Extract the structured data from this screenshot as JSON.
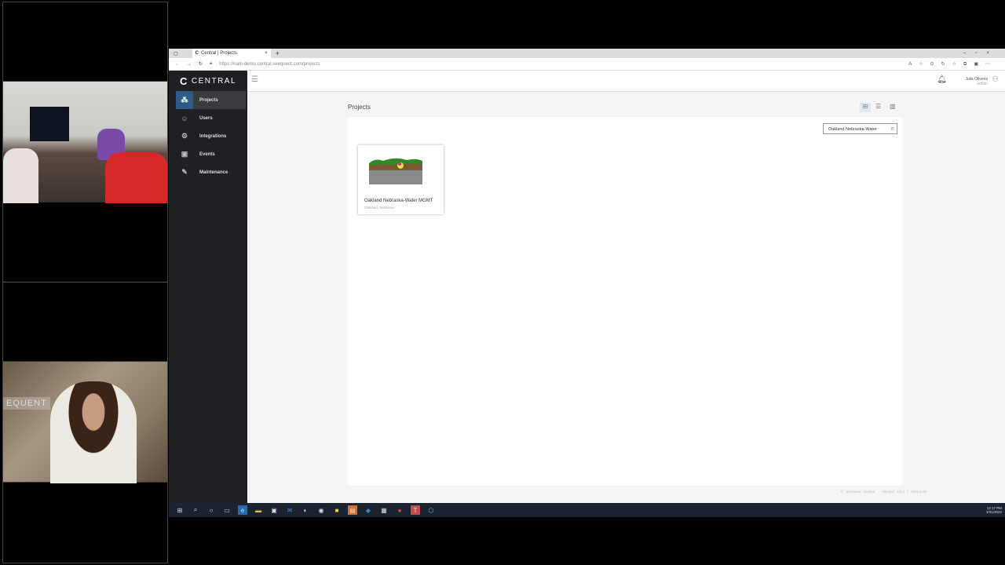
{
  "video": {
    "watermark": "EQUENT"
  },
  "browser": {
    "tab_title": "Central | Projects",
    "url": "https://nam-demo.central.seequent.com/projects",
    "new_tab": "+",
    "close_tab": "×"
  },
  "app": {
    "logo": "CENTRAL",
    "logo_mark": "C"
  },
  "sidebar": {
    "items": [
      {
        "label": "Projects",
        "icon": "⁂"
      },
      {
        "label": "Users",
        "icon": "☺"
      },
      {
        "label": "Integrations",
        "icon": "⚙"
      },
      {
        "label": "Events",
        "icon": "▣"
      },
      {
        "label": "Maintenance",
        "icon": "✎"
      }
    ]
  },
  "header": {
    "user_name": "Julia Oliveira",
    "user_role": "admin"
  },
  "main": {
    "title": "Projects",
    "search_value": "Oakland Nebraska-Water",
    "projects": [
      {
        "name": "Oakland Nebraska-Water MGMT",
        "location": "Oakland, Nebraska"
      }
    ]
  },
  "footer": {
    "copyright": "© Seequent Limited",
    "version": "Version 4.0.1 | 2022.2.25"
  },
  "taskbar": {
    "time": "12:17 PM",
    "date": "3/31/2022"
  },
  "colors": {
    "sidebar": "#1f2023",
    "active": "#2d5b86"
  }
}
